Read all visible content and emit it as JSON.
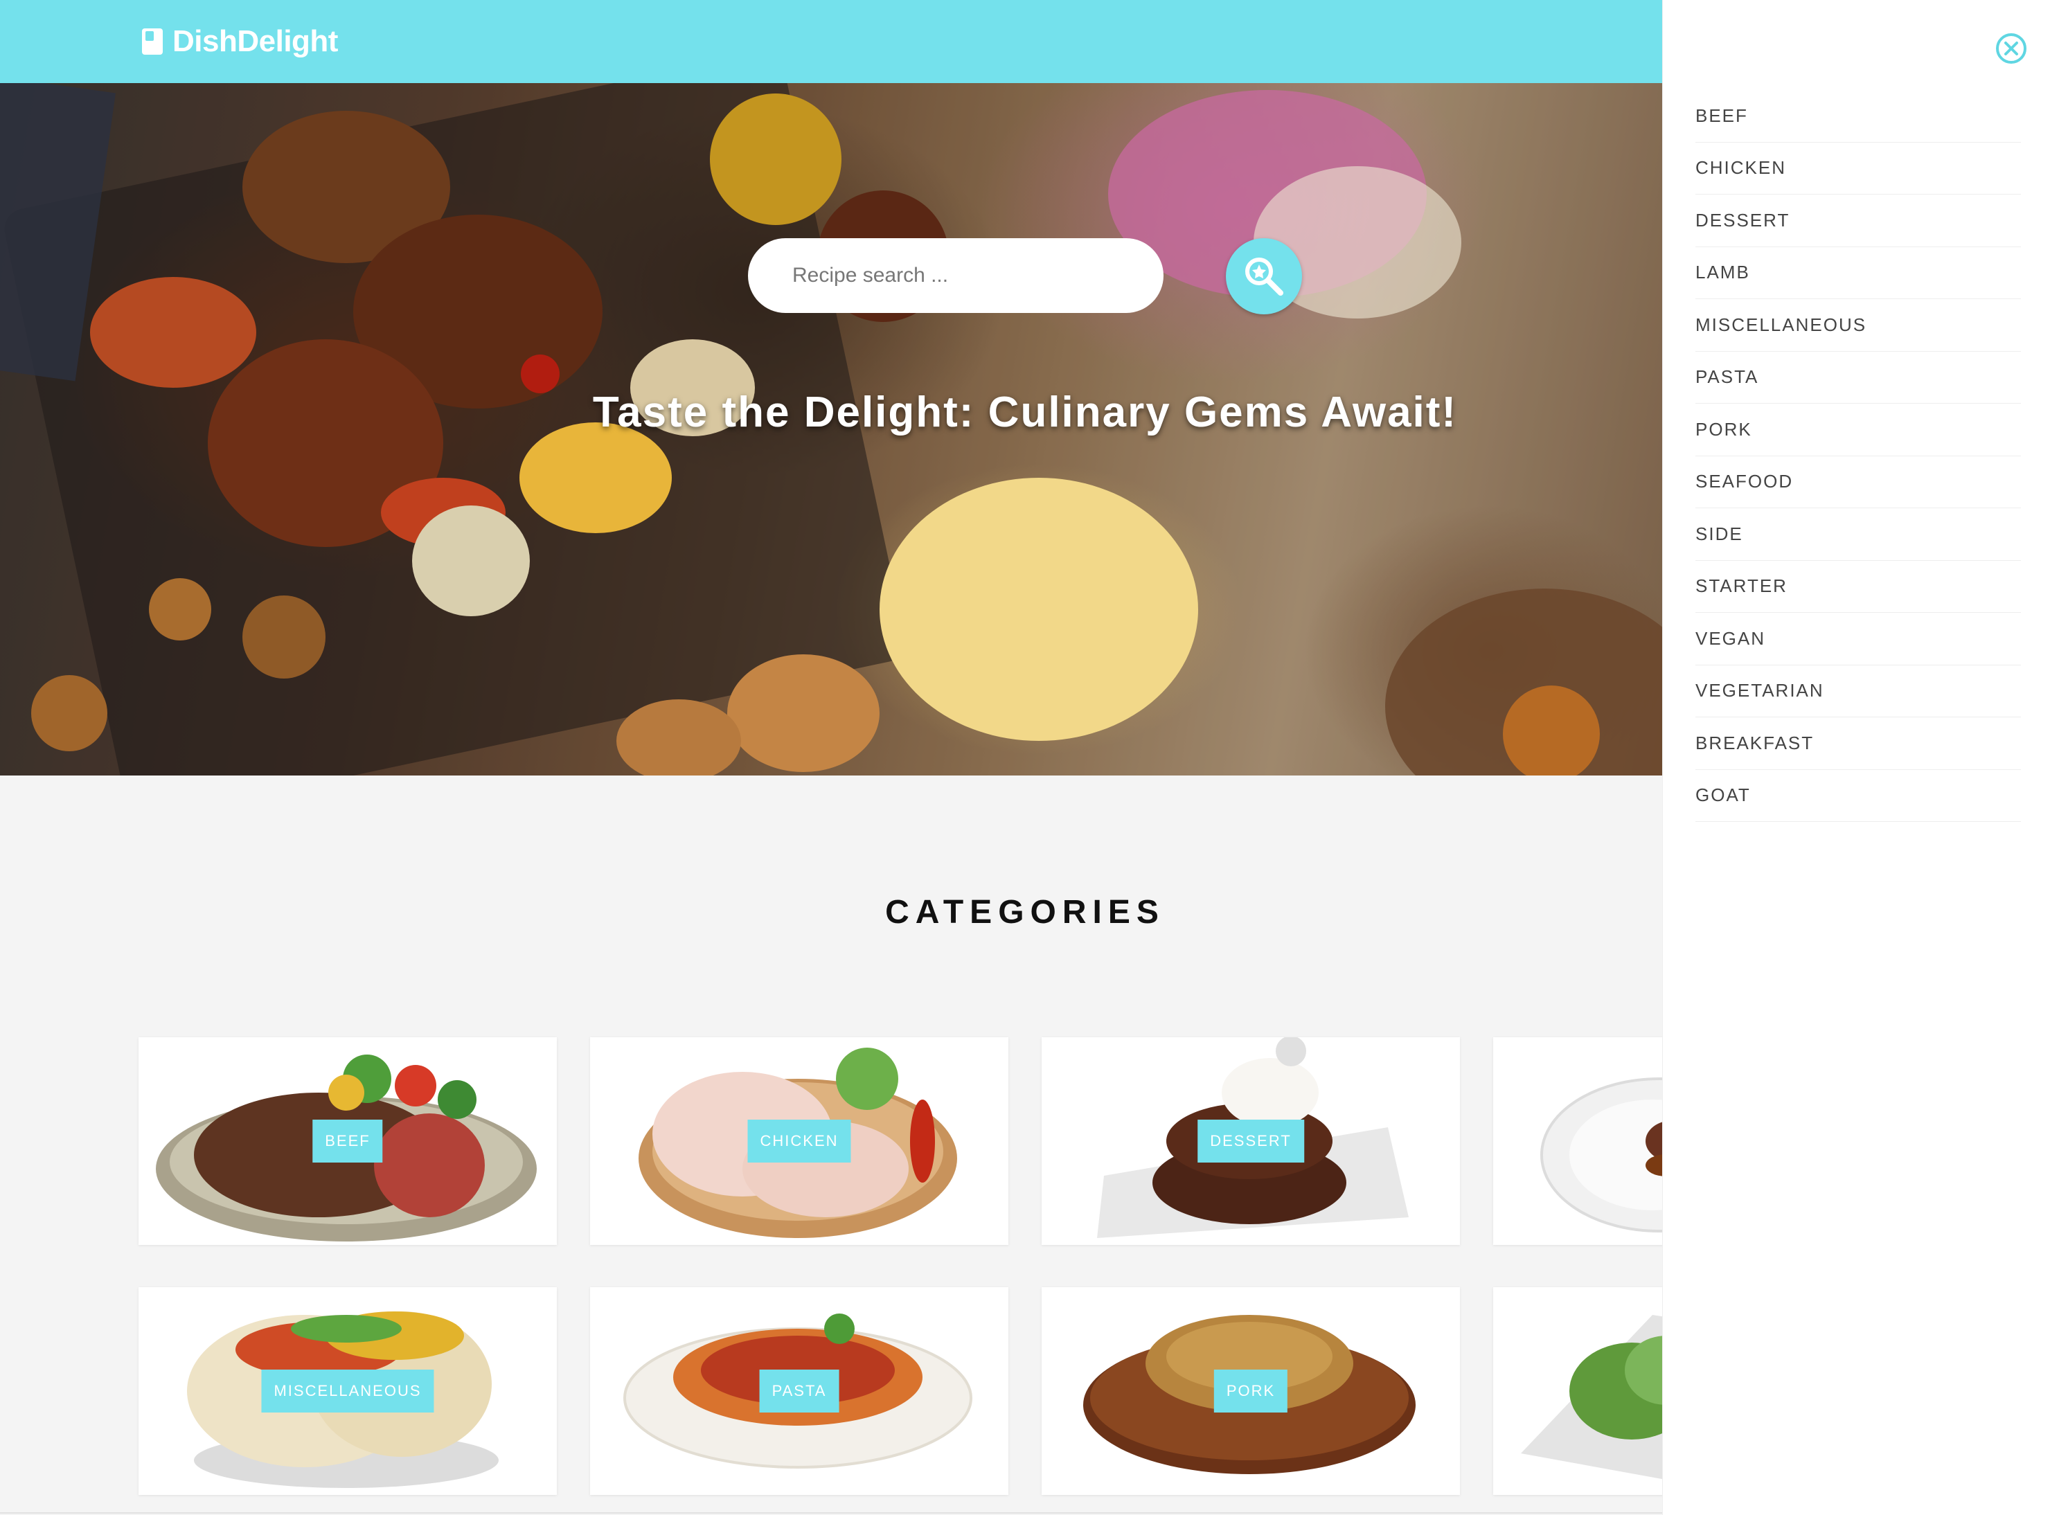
{
  "header": {
    "brand": "DishDelight",
    "accent_color": "#74e1ec"
  },
  "hero": {
    "search_placeholder": "Recipe search ...",
    "search_icon": "search-icon",
    "title": "Taste the Delight: Culinary Gems Await!"
  },
  "categories": {
    "heading": "CATEGORIES",
    "cards": [
      {
        "label": "BEEF"
      },
      {
        "label": "CHICKEN"
      },
      {
        "label": "DESSERT"
      },
      {
        "label": ""
      },
      {
        "label": "MISCELLANEOUS"
      },
      {
        "label": "PASTA"
      },
      {
        "label": "PORK"
      },
      {
        "label": ""
      }
    ]
  },
  "side_panel": {
    "close_icon": "close-icon",
    "items": [
      {
        "label": "BEEF"
      },
      {
        "label": "CHICKEN"
      },
      {
        "label": "DESSERT"
      },
      {
        "label": "LAMB"
      },
      {
        "label": "MISCELLANEOUS"
      },
      {
        "label": "PASTA"
      },
      {
        "label": "PORK"
      },
      {
        "label": "SEAFOOD"
      },
      {
        "label": "SIDE"
      },
      {
        "label": "STARTER"
      },
      {
        "label": "VEGAN"
      },
      {
        "label": "VEGETARIAN"
      },
      {
        "label": "BREAKFAST"
      },
      {
        "label": "GOAT"
      }
    ]
  }
}
